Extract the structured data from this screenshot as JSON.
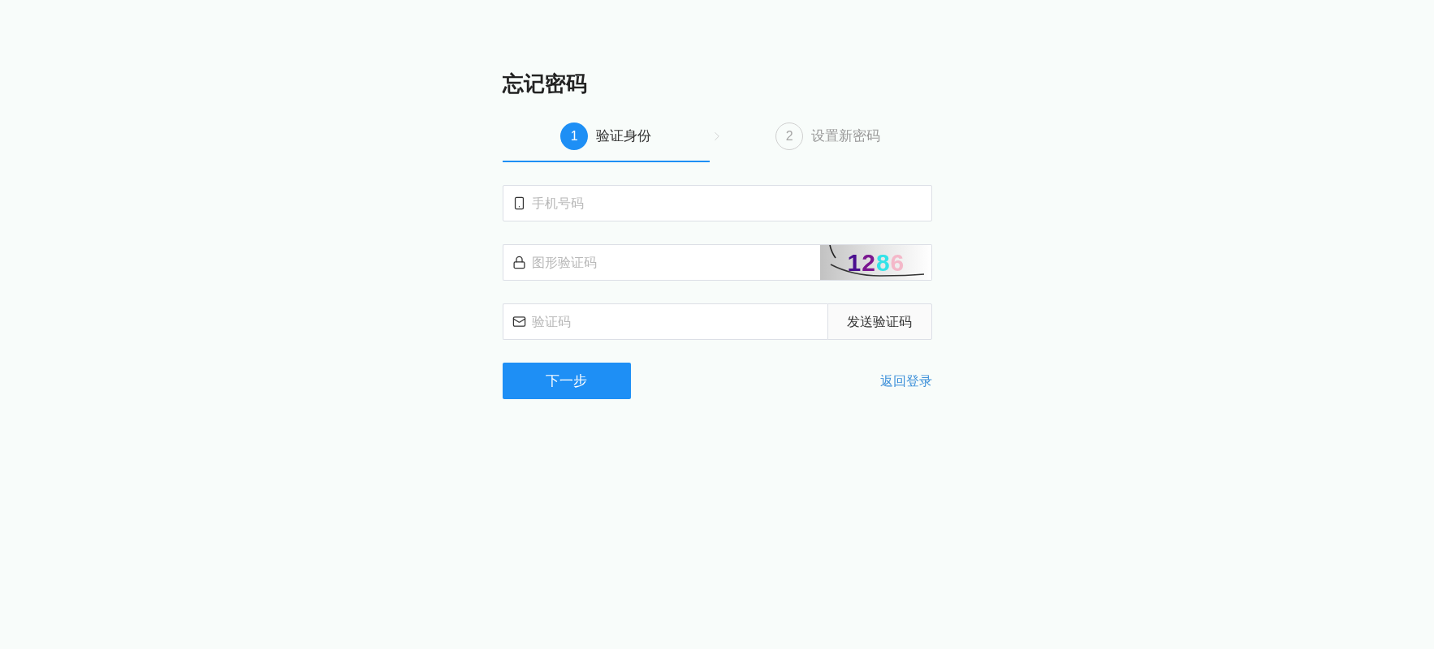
{
  "title": "忘记密码",
  "steps": [
    {
      "number": "1",
      "label": "验证身份",
      "selected": true
    },
    {
      "number": "2",
      "label": "设置新密码",
      "selected": false
    }
  ],
  "fields": [
    {
      "kind": "phone",
      "placeholder": "手机号码"
    },
    {
      "kind": "captcha",
      "placeholder": "图形验证码",
      "captcha_code": "1286"
    },
    {
      "kind": "sms",
      "placeholder": "验证码",
      "button": "发送验证码"
    }
  ],
  "next_button": "下一步",
  "back_link": "返回登录"
}
